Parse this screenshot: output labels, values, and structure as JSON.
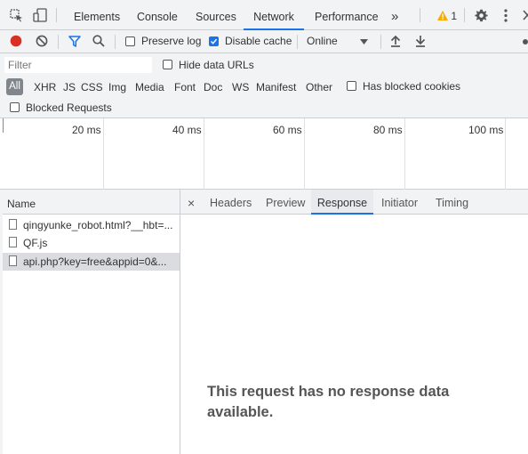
{
  "tabs": [
    "Elements",
    "Console",
    "Sources",
    "Network",
    "Performance"
  ],
  "active_tab": "Network",
  "more_tabs_glyph": "»",
  "warning_count": "1",
  "toolbar": {
    "preserve_log": "Preserve log",
    "preserve_log_checked": false,
    "disable_cache": "Disable cache",
    "disable_cache_checked": true,
    "throttle": "Online"
  },
  "filter": {
    "placeholder": "Filter",
    "hide_data_urls": "Hide data URLs",
    "types": [
      "All",
      "XHR",
      "JS",
      "CSS",
      "Img",
      "Media",
      "Font",
      "Doc",
      "WS",
      "Manifest",
      "Other"
    ],
    "has_blocked_cookies": "Has blocked cookies",
    "blocked_requests": "Blocked Requests"
  },
  "timeline": {
    "ticks": [
      "20 ms",
      "40 ms",
      "60 ms",
      "80 ms",
      "100 ms"
    ]
  },
  "list": {
    "header": "Name",
    "rows": [
      "qingyunke_robot.html?__hbt=...",
      "QF.js",
      "api.php?key=free&appid=0&..."
    ],
    "selected_index": 2
  },
  "detail": {
    "close_glyph": "×",
    "tabs": [
      "Headers",
      "Preview",
      "Response",
      "Initiator",
      "Timing"
    ],
    "active_tab": "Response",
    "empty_message_line1": "This request has no response data",
    "empty_message_line2": "available."
  },
  "colors": {
    "accent": "#1a73e8",
    "record": "#d93025",
    "warning": "#f9ab00"
  },
  "icons": [
    "inspect-icon",
    "device-toolbar-icon",
    "warning-icon",
    "settings-gear-icon",
    "more-vert-icon",
    "close-icon",
    "record-icon",
    "clear-icon",
    "filter-icon",
    "search-icon",
    "dropdown-arrow-icon",
    "import-har-icon",
    "export-har-icon",
    "network-settings-gear-icon",
    "document-icon"
  ]
}
